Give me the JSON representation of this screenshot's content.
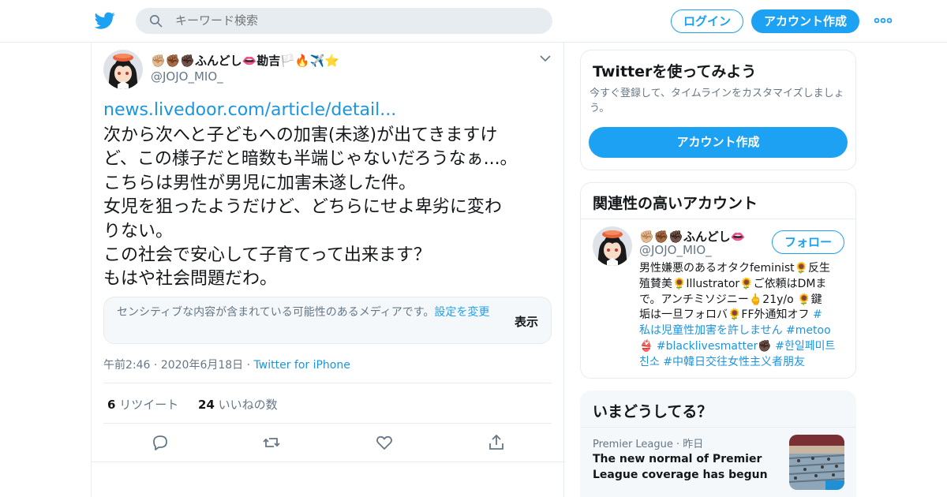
{
  "header": {
    "search_placeholder": "キーワード検索",
    "login_label": "ログイン",
    "signup_label": "アカウント作成",
    "brand_color": "#1da1f2"
  },
  "tweet": {
    "author_name": "✊🏼✊🏾✊🏿ふんどし👄勘吉🏳️🔥✈️⭐",
    "author_handle": "@JOJO_MIO_",
    "link_text": "news.livedoor.com/article/detail...",
    "text_lines": [
      "次から次へと子どもへの加害(未遂)が出てきますけ",
      "ど、この様子だと暗数も半端じゃないだろうなぁ...。",
      "こちらは男性が男児に加害未遂した件。",
      "女児を狙ったようだけど、どちらにせよ卑劣に変わ",
      "りない。",
      "この社会で安心して子育てって出来ます？",
      "もはや社会問題だわ。"
    ],
    "sensitive": {
      "message": "センシティブな内容が含まれている可能性のあるメディアです。",
      "settings_link": "設定を変更",
      "show_label": "表示"
    },
    "time": "午前2:46",
    "date": "2020年6月18日",
    "source": "Twitter for iPhone",
    "retweets_count": "6",
    "retweets_label": "リツイート",
    "likes_count": "24",
    "likes_label": "いいねの数"
  },
  "signup_card": {
    "title": "Twitterを使ってみよう",
    "description": "今すぐ登録して、タイムラインをカスタマイズしましょう。",
    "button_label": "アカウント作成"
  },
  "related": {
    "title": "関連性の高いアカウント",
    "account_name": "✊🏼✊🏾✊🏿ふんどし👄",
    "account_handle": "@JOJO_MIO_",
    "follow_label": "フォロー",
    "bio_lines": [
      [
        "男性嫌悪のあるオタクfeminist🌻反生",
        ""
      ],
      [
        "殖賛美🌻Illustrator🌻ご依頼はDMま",
        ""
      ],
      [
        "で。アンチミソジニー🖕21y/o 🌻鍵",
        ""
      ],
      [
        "垢は一旦フォロバ🌻FF外通知オフ ",
        "#"
      ],
      [
        "",
        "私は児童性加害を許しません #metoo"
      ],
      [
        "👙 ",
        "#blacklivesmatter",
        "✊🏿 ",
        "#한일페미트"
      ],
      [
        "",
        "친소 #中韓日交往女性主义者朋友"
      ]
    ]
  },
  "trends": {
    "title": "いまどうしてる？",
    "item_category": "Premier League",
    "item_time": "昨日",
    "item_headline": "The new normal of Premier League coverage has begun"
  }
}
